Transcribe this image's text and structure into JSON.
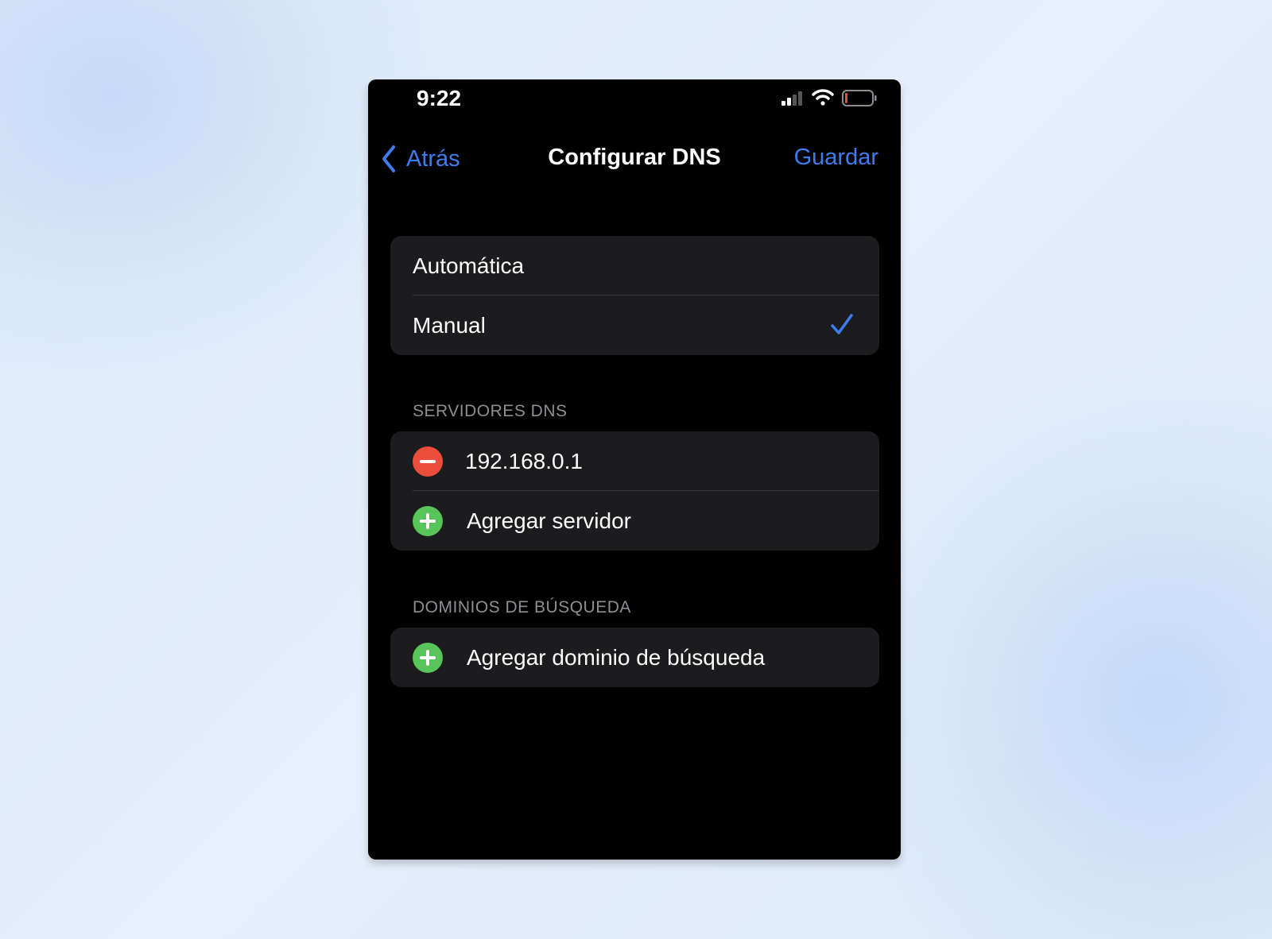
{
  "status_bar": {
    "time": "9:22",
    "icons": [
      "cellular-signal-icon",
      "wifi-icon",
      "battery-low-icon"
    ]
  },
  "nav": {
    "back_label": "Atrás",
    "title": "Configurar DNS",
    "save_label": "Guardar"
  },
  "mode": {
    "options": [
      "Automática",
      "Manual"
    ],
    "selected": "Manual"
  },
  "dns_servers": {
    "header": "SERVIDORES DNS",
    "servers": [
      "192.168.0.1"
    ],
    "add_label": "Agregar servidor"
  },
  "search_domains": {
    "header": "DOMINIOS DE BÚSQUEDA",
    "add_label": "Agregar dominio de búsqueda"
  },
  "colors": {
    "accent": "#3f7cf0",
    "remove": "#eb4d3d",
    "add": "#58c55a",
    "cell_background": "#1c1c1e",
    "screen_background": "#000000"
  }
}
